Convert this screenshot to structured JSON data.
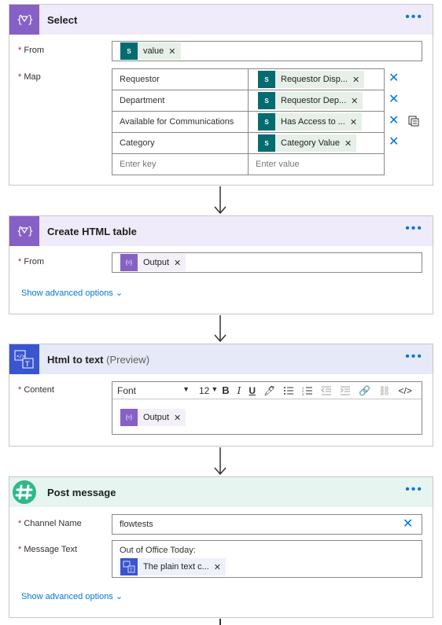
{
  "select": {
    "title": "Select",
    "from_label": "From",
    "from_token": "value",
    "map_label": "Map",
    "rows": [
      {
        "key": "Requestor",
        "value": "Requestor Disp..."
      },
      {
        "key": "Department",
        "value": "Requestor Dep..."
      },
      {
        "key": "Available for Communications",
        "value": "Has Access to ..."
      },
      {
        "key": "Category",
        "value": "Category Value"
      }
    ],
    "key_placeholder": "Enter key",
    "value_placeholder": "Enter value"
  },
  "create_table": {
    "title": "Create HTML table",
    "from_label": "From",
    "from_token": "Output",
    "advanced": "Show advanced options"
  },
  "html_to_text": {
    "title": "Html to text",
    "title_suffix": "(Preview)",
    "content_label": "Content",
    "font": "Font",
    "font_size": "12",
    "content_token": "Output"
  },
  "post_message": {
    "title": "Post message",
    "channel_label": "Channel Name",
    "channel_value": "flowtests",
    "message_label": "Message Text",
    "message_line": "Out of Office Today:",
    "message_token": "The plain text c...",
    "advanced": "Show advanced options"
  },
  "colors": {
    "select_header": "#efebfa",
    "html_header": "#e6e9f8",
    "slack_header": "#e6f5ef",
    "accent": "#0078d4"
  }
}
